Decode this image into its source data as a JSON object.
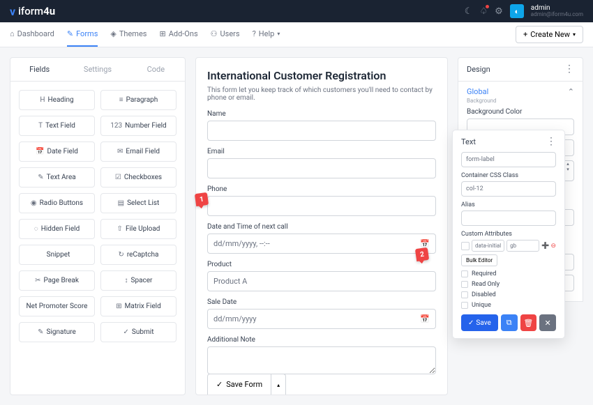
{
  "brand": {
    "mark": "v",
    "name": "iform",
    "suffix": "4u"
  },
  "user": {
    "name": "admin",
    "email": "admin@iform4u.com"
  },
  "nav": {
    "items": [
      {
        "icon": "⌂",
        "label": "Dashboard"
      },
      {
        "icon": "✎",
        "label": "Forms"
      },
      {
        "icon": "◈",
        "label": "Themes"
      },
      {
        "icon": "⊞",
        "label": "Add-Ons"
      },
      {
        "icon": "⚇",
        "label": "Users"
      },
      {
        "icon": "?",
        "label": "Help"
      }
    ],
    "create": "Create New"
  },
  "tabs": {
    "fields": "Fields",
    "settings": "Settings",
    "code": "Code"
  },
  "fields": [
    {
      "icon": "H",
      "label": "Heading"
    },
    {
      "icon": "≡",
      "label": "Paragraph"
    },
    {
      "icon": "T",
      "label": "Text Field"
    },
    {
      "icon": "123",
      "label": "Number Field"
    },
    {
      "icon": "📅",
      "label": "Date Field"
    },
    {
      "icon": "✉",
      "label": "Email Field"
    },
    {
      "icon": "✎",
      "label": "Text Area"
    },
    {
      "icon": "☑",
      "label": "Checkboxes"
    },
    {
      "icon": "◉",
      "label": "Radio Buttons"
    },
    {
      "icon": "▤",
      "label": "Select List"
    },
    {
      "icon": "◌",
      "label": "Hidden Field"
    },
    {
      "icon": "⇧",
      "label": "File Upload"
    },
    {
      "icon": "</>",
      "label": "Snippet"
    },
    {
      "icon": "↻",
      "label": "reCaptcha"
    },
    {
      "icon": "✂",
      "label": "Page Break"
    },
    {
      "icon": "↕",
      "label": "Spacer"
    },
    {
      "icon": "",
      "label": "Net Promoter Score"
    },
    {
      "icon": "⊞",
      "label": "Matrix Field"
    },
    {
      "icon": "✎",
      "label": "Signature"
    },
    {
      "icon": "✓",
      "label": "Submit"
    }
  ],
  "form": {
    "title": "International Customer Registration",
    "desc": "This form let you keep track of which customers you'll need to contact by phone or email.",
    "name_label": "Name",
    "email_label": "Email",
    "phone_label": "Phone",
    "datetime_label": "Date and Time of next call",
    "datetime_placeholder": "dd/mm/yyyy, --:--",
    "product_label": "Product",
    "product_value": "Product A",
    "saledate_label": "Sale Date",
    "saledate_placeholder": "dd/mm/yyyy",
    "note_label": "Additional Note",
    "save": "Save Form"
  },
  "design": {
    "header": "Design",
    "global": "Global",
    "background": "Background",
    "bgcolor": "Background Color"
  },
  "popup": {
    "header": "Text",
    "css_value": "form-label",
    "container_label": "Container CSS Class",
    "container_value": "col-12",
    "alias_label": "Alias",
    "custom_attr_label": "Custom Attributes",
    "attr_key": "data-initial-",
    "attr_val": "gb",
    "bulk": "Bulk Editor",
    "required": "Required",
    "readonly": "Read Only",
    "disabled": "Disabled",
    "unique": "Unique",
    "save": "Save"
  },
  "markers": {
    "m1": "1",
    "m2": "2"
  }
}
